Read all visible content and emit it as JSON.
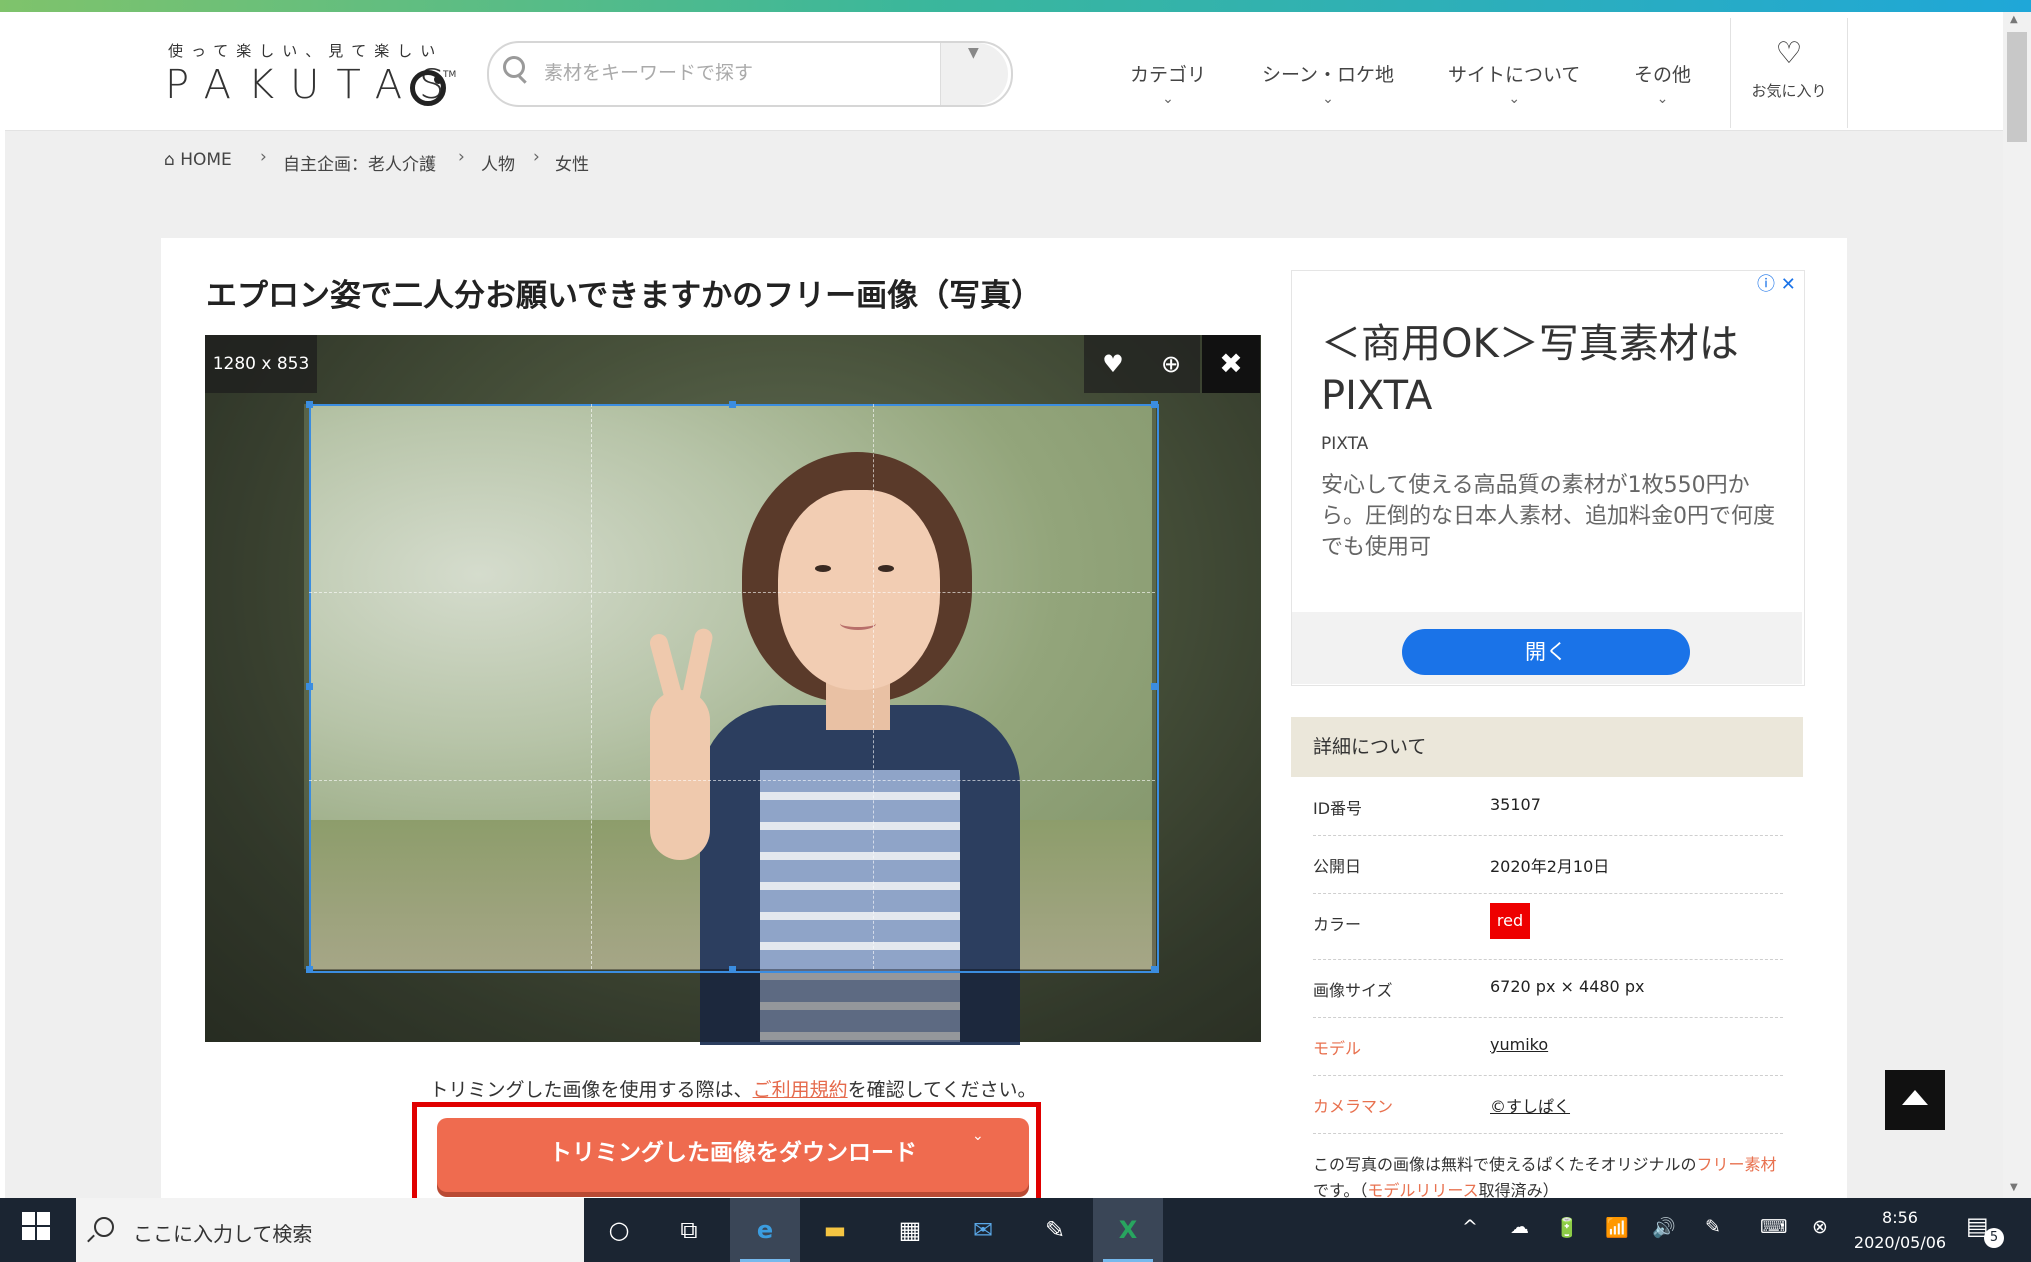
{
  "header": {
    "tagline": "使って楽しい、見て楽しい",
    "logo_text": "PAKUTAS",
    "logo_tm": "TM",
    "search_placeholder": "素材をキーワードで探す",
    "search_drop": "▼",
    "nav": [
      "カテゴリ",
      "シーン・ロケ地",
      "サイトについて",
      "その他"
    ],
    "nav_chevron": "⌄",
    "favorites_label": "お気に入り",
    "favorites_icon": "heart-outline-icon"
  },
  "breadcrumb": {
    "home": "HOME",
    "items": [
      "自主企画：老人介護",
      "人物",
      "女性"
    ],
    "separator": "›"
  },
  "main": {
    "title": "エプロン姿で二人分お願いできますかのフリー画像（写真）",
    "image_size_badge": "1280 x 853",
    "tools": {
      "favorite": "♥",
      "zoom": "⊕",
      "close": "✖"
    },
    "notice_before": "トリミングした画像を使用する際は、",
    "notice_link": "ご利用規約",
    "notice_after": "を確認してください。",
    "download_button": "トリミングした画像をダウンロード",
    "download_chevron": "⌄"
  },
  "ad": {
    "icons": "ⓘ ✕",
    "headline": "＜商用OK＞写真素材はPIXTA",
    "source": "PIXTA",
    "body": "安心して使える高品質の素材が1枚550円から。圧倒的な日本人素材、追加料金0円で何度でも使用可",
    "button": "開く"
  },
  "details": {
    "heading": "詳細について",
    "rows": [
      {
        "key": "ID番号",
        "value": "35107"
      },
      {
        "key": "公開日",
        "value": "2020年2月10日"
      },
      {
        "key": "カラー",
        "value": "red"
      },
      {
        "key": "画像サイズ",
        "value": "6720 px × 4480 px"
      },
      {
        "key": "モデル",
        "value": "yumiko"
      },
      {
        "key": "カメラマン",
        "value": "©すしぱく"
      }
    ],
    "note_before": "この写真の画像は無料で使えるぱくたそオリジナルの",
    "note_link1": "フリー素材",
    "note_mid": "です。（",
    "note_link2": "モデルリリース",
    "note_after": "取得済み）"
  },
  "colors": {
    "accent_orange": "#ef6b4f",
    "highlight_red": "#e00000",
    "ad_blue": "#1a73e8",
    "crop_blue": "#3b8de0"
  },
  "taskbar": {
    "search_text": "ここに入力して検索",
    "apps": [
      "cortana-icon",
      "task-view-icon",
      "edge-icon",
      "file-explorer-icon",
      "store-icon",
      "mail-icon",
      "paint-icon",
      "excel-icon"
    ],
    "tray": [
      "^",
      "☁",
      "🔋",
      "📶",
      "🔊",
      "✎",
      "⌨",
      "⊗"
    ],
    "time": "8:56",
    "date": "2020/05/06",
    "notification_count": "5"
  }
}
